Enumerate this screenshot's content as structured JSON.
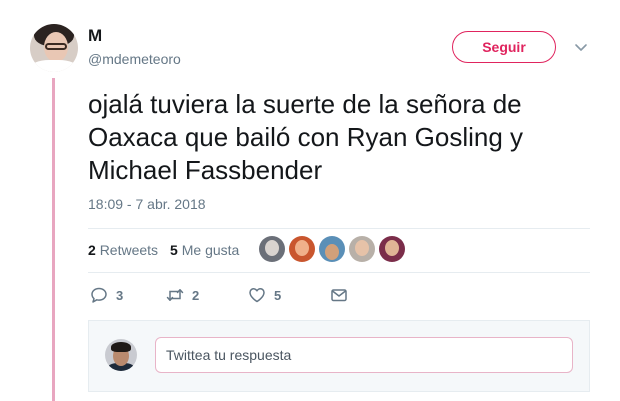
{
  "tweet": {
    "display_name": "M",
    "handle": "@mdemeteoro",
    "text": "ojalá tuviera la suerte de la señora de\nOaxaca que bailó con Ryan Gosling y\nMichael Fassbender",
    "timestamp": "18:09 - 7 abr. 2018"
  },
  "follow_button": {
    "label": "Seguir",
    "color": "#e0245e"
  },
  "stats": {
    "retweets_count": "2",
    "retweets_label": "Retweets",
    "likes_count": "5",
    "likes_label": "Me gusta"
  },
  "actions": {
    "replies": "3",
    "retweets": "2",
    "likes": "5"
  },
  "reply": {
    "placeholder": "Twittea tu respuesta"
  },
  "colors": {
    "accent": "#e0245e",
    "thread_line": "#e8a6c0",
    "muted_text": "#657786"
  }
}
